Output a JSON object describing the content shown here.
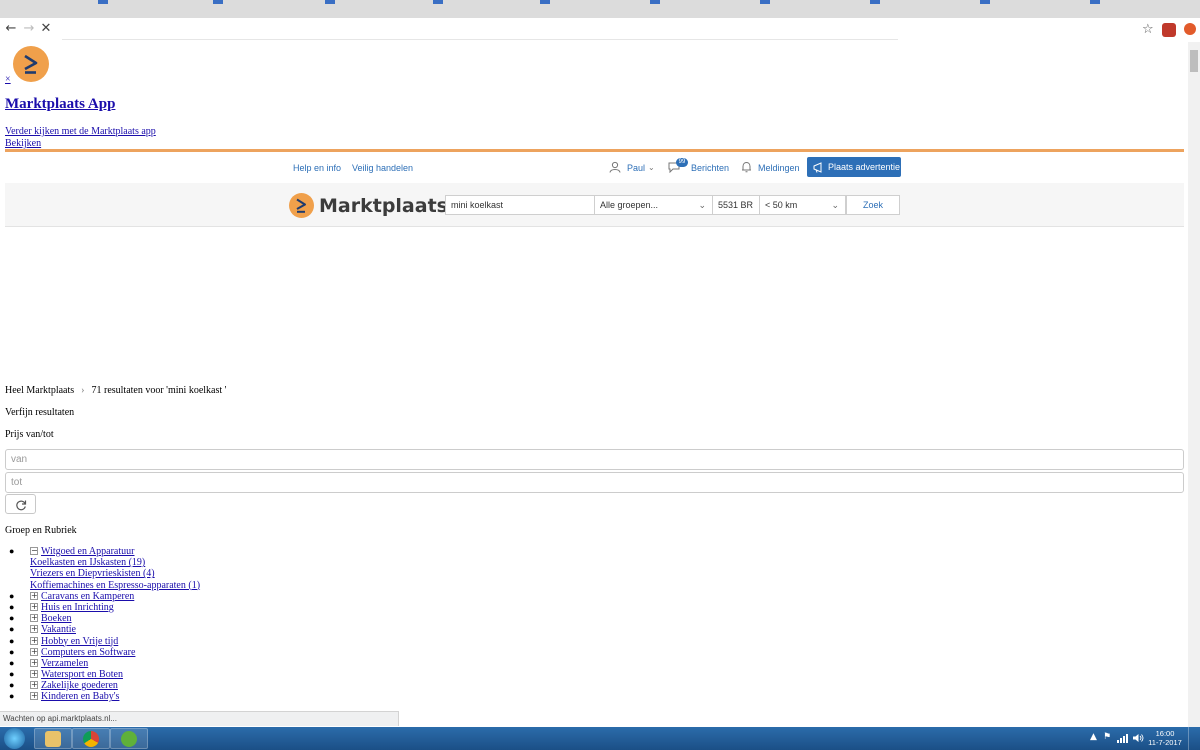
{
  "browser": {
    "back_glyph": "←",
    "forward_glyph": "→",
    "stop_glyph": "✕",
    "address": "",
    "star_glyph": "☆"
  },
  "banner": {
    "close_label": "×",
    "title": "Marktplaats App",
    "subtitle": "Verder kijken met de Marktplaats app",
    "cta": "Bekijken"
  },
  "topnav": {
    "help": "Help en info",
    "safe": "Veilig handelen",
    "user": "Paul",
    "messages": "Berichten",
    "messages_badge": "99",
    "notifications": "Meldingen",
    "place_ad": "Plaats advertentie"
  },
  "search": {
    "brand": "Marktplaats",
    "query": "mini koelkast",
    "category": "Alle groepen...",
    "postcode": "5531 BR",
    "distance": "< 50 km",
    "submit": "Zoek"
  },
  "results": {
    "breadcrumb_home": "Heel Marktplaats",
    "breadcrumb_sep": "›",
    "breadcrumb_results": "71 resultaten voor 'mini koelkast '"
  },
  "filters": {
    "refine_title": "Verfijn resultaten",
    "price_title": "Prijs van/tot",
    "price_from_placeholder": "van",
    "price_to_placeholder": "tot",
    "group_title": "Groep en Rubriek",
    "categories": [
      {
        "label": "Witgoed en Apparatuur",
        "box": "−",
        "children": [
          "Koelkasten en IJskasten (19)",
          "Vriezers en Diepvrieskisten (4)",
          "Koffiemachines en Espresso-apparaten (1)"
        ]
      },
      {
        "label": "Caravans en Kamperen",
        "box": "+"
      },
      {
        "label": "Huis en Inrichting",
        "box": "+"
      },
      {
        "label": "Boeken",
        "box": "+"
      },
      {
        "label": "Vakantie",
        "box": "+"
      },
      {
        "label": "Hobby en Vrije tijd",
        "box": "+"
      },
      {
        "label": "Computers en Software",
        "box": "+"
      },
      {
        "label": "Verzamelen",
        "box": "+"
      },
      {
        "label": "Watersport en Boten",
        "box": "+"
      },
      {
        "label": "Zakelijke goederen",
        "box": "+"
      },
      {
        "label": "Kinderen en Baby's",
        "box": "+"
      }
    ]
  },
  "status": {
    "text": "Wachten op api.marktplaats.nl..."
  },
  "taskbar": {
    "time": "16:00",
    "date": "11-7-2017",
    "tray_flag": "⚑",
    "tray_arrow": "▲"
  },
  "colors": {
    "brand_orange": "#f0a04b",
    "link_blue": "#2d6fb7",
    "banner_rule": "#eda35e",
    "taskbar": "#2b6cab"
  }
}
